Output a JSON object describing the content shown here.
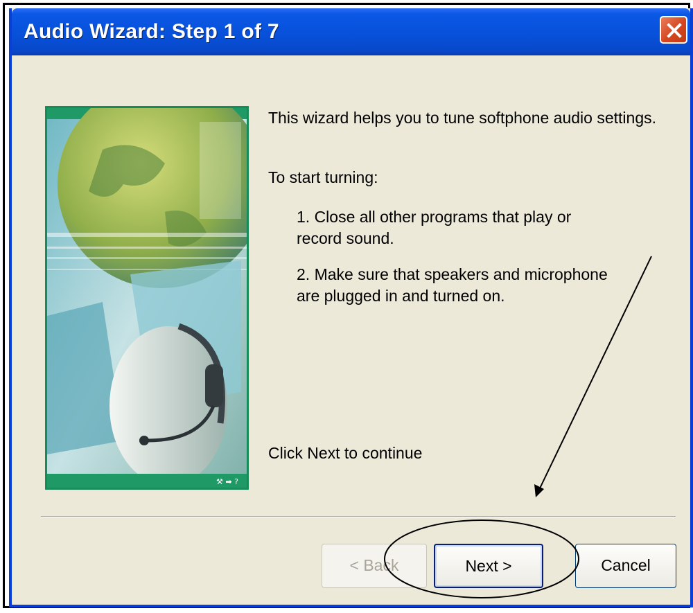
{
  "window": {
    "title": "Audio Wizard: Step 1 of 7"
  },
  "content": {
    "intro": "This wizard helps you to tune softphone audio settings.",
    "start_heading": "To start turning:",
    "step1_line1": "1. Close all other programs that play or",
    "step1_line2": "record sound.",
    "step2_line1": "2. Make sure that speakers and microphone",
    "step2_line2": "are plugged in and turned on.",
    "footer_hint": "Click Next to continue"
  },
  "buttons": {
    "back_label": "< Back",
    "next_label": "Next >",
    "cancel_label": "Cancel"
  },
  "icons": [
    "close-icon",
    "wizard-banner-image",
    "annotation-arrow",
    "annotation-ellipse"
  ],
  "colors": {
    "title_bar": "#0750d8",
    "dialog_bg": "#ece9d8",
    "banner_border": "#168c5a",
    "close_button": "#d54620"
  }
}
